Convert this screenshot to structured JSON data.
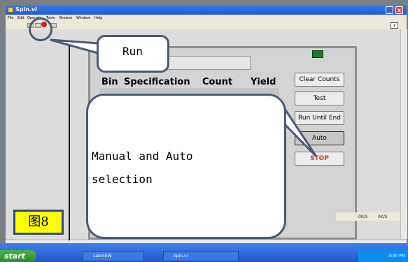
{
  "window": {
    "title": "Spin.vi",
    "menu": [
      "File",
      "Edit",
      "Operate",
      "Tools",
      "Browse",
      "Window",
      "Help"
    ]
  },
  "front_panel": {
    "table_headers": [
      "Bin",
      "Specification",
      "Count",
      "Yield"
    ],
    "buttons": [
      "Clear Counts",
      "Test",
      "Run Until End",
      "Auto",
      "STOP"
    ]
  },
  "callouts": {
    "run": "Run",
    "mode_line1": "Manual and Auto",
    "mode_line2": "selection"
  },
  "figure_label": "图8",
  "status": {
    "readout1": "0K/S",
    "readout2": "0K/S"
  },
  "taskbar": {
    "start": "start",
    "items": [
      "LabVIEW",
      "Spin.vi"
    ],
    "clock": "3:30 PM"
  },
  "colors": {
    "callout_border": "#4a5b75",
    "figure_label_bg": "#ffff00",
    "stop_text": "#e53030",
    "led": "#1f7a26"
  }
}
